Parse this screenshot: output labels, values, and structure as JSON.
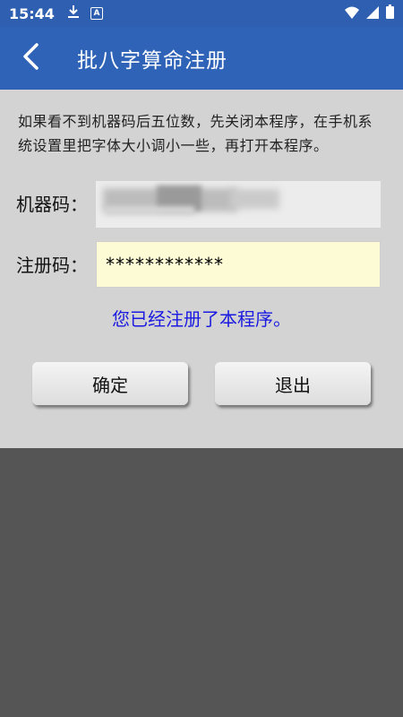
{
  "status_bar": {
    "time": "15:44",
    "icons_left": [
      "download-icon",
      "a-badge-icon"
    ],
    "icons_right": [
      "wifi-icon",
      "signal-icon",
      "battery-icon"
    ],
    "a_badge_text": "A"
  },
  "app_bar": {
    "title": "批八字算命注册",
    "back_icon": "chevron-left-icon",
    "color": "#2f63b8"
  },
  "main": {
    "notice": "如果看不到机器码后五位数，先关闭本程序，在手机系统设置里把字体大小调小一些，再打开本程序。",
    "machine_code_label": "机器码：",
    "machine_code_value": "",
    "reg_code_label": "注册码：",
    "reg_code_value": "************",
    "reg_status": "您已经注册了本程序。",
    "reg_status_color": "#1a1ae0",
    "ok_button": "确定",
    "exit_button": "退出"
  }
}
